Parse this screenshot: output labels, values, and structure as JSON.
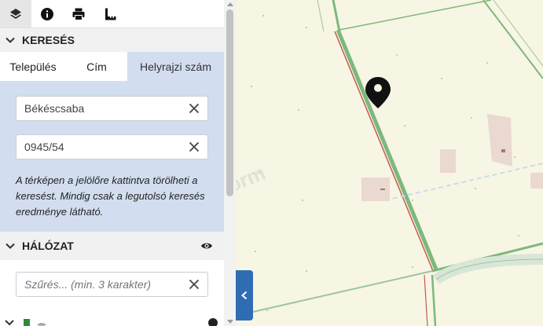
{
  "toolbar": {
    "icons": [
      "layers-icon",
      "info-icon",
      "print-icon",
      "measure-icon"
    ]
  },
  "search": {
    "title": "KERESÉS",
    "tabs": [
      {
        "label": "Település"
      },
      {
        "label": "Cím"
      },
      {
        "label": "Helyrajzi szám"
      }
    ],
    "active_tab": "Helyrajzi szám",
    "settlement_value": "Békéscsaba",
    "parcel_value": "0945/54",
    "hint": "A térképen a jelölőre kattintva törölheti a keresést. Mindig csak a legutolsó keresés eredménye látható."
  },
  "network": {
    "title": "HÁLÓZAT",
    "filter_placeholder": "Szűrés... (min. 3 karakter)"
  },
  "watermark": "Agroinform",
  "colors": {
    "accent_blue": "#2f6db3",
    "panel_blue": "#d2deef",
    "map_background": "#f7f5e3",
    "parcel_border": "#7db87d",
    "parcel_red": "#c25b4f",
    "dirt_road": "#b8d8e8"
  }
}
